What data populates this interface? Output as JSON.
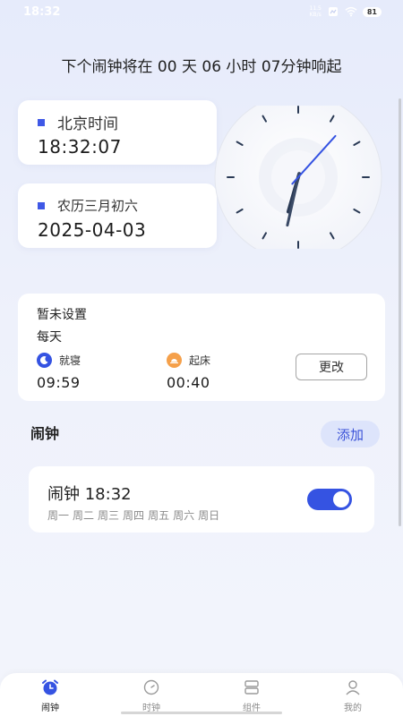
{
  "status_bar": {
    "time": "18:32",
    "net_speed_value": "11.5",
    "net_speed_unit": "KB/s",
    "battery": "81"
  },
  "countdown": {
    "text": "下个闹钟将在 00 天 06 小时 07分钟响起"
  },
  "beijing": {
    "label": "北京时间",
    "time": "18:32:07"
  },
  "lunar": {
    "label": "农历三月初六",
    "date": "2025-04-03"
  },
  "clock": {
    "hour": 18,
    "minute": 32,
    "second": 7
  },
  "sleep": {
    "title": "暂未设置",
    "repeat": "每天",
    "bed_label": "就寝",
    "bed_time": "09:59",
    "wake_label": "起床",
    "wake_time": "00:40",
    "change_label": "更改"
  },
  "alarm_section": {
    "title": "闹钟",
    "add_label": "添加"
  },
  "alarms": [
    {
      "name": "闹钟 18:32",
      "days": [
        "周一",
        "周二",
        "周三",
        "周四",
        "周五",
        "周六",
        "周日"
      ],
      "enabled": true
    }
  ],
  "tabs": [
    {
      "label": "闹钟",
      "icon": "alarm-clock-icon",
      "active": true
    },
    {
      "label": "时钟",
      "icon": "clock-icon",
      "active": false
    },
    {
      "label": "组件",
      "icon": "widgets-icon",
      "active": false
    },
    {
      "label": "我的",
      "icon": "person-icon",
      "active": false
    }
  ],
  "colors": {
    "accent": "#3553e2",
    "accent_light": "#dde4fb"
  }
}
